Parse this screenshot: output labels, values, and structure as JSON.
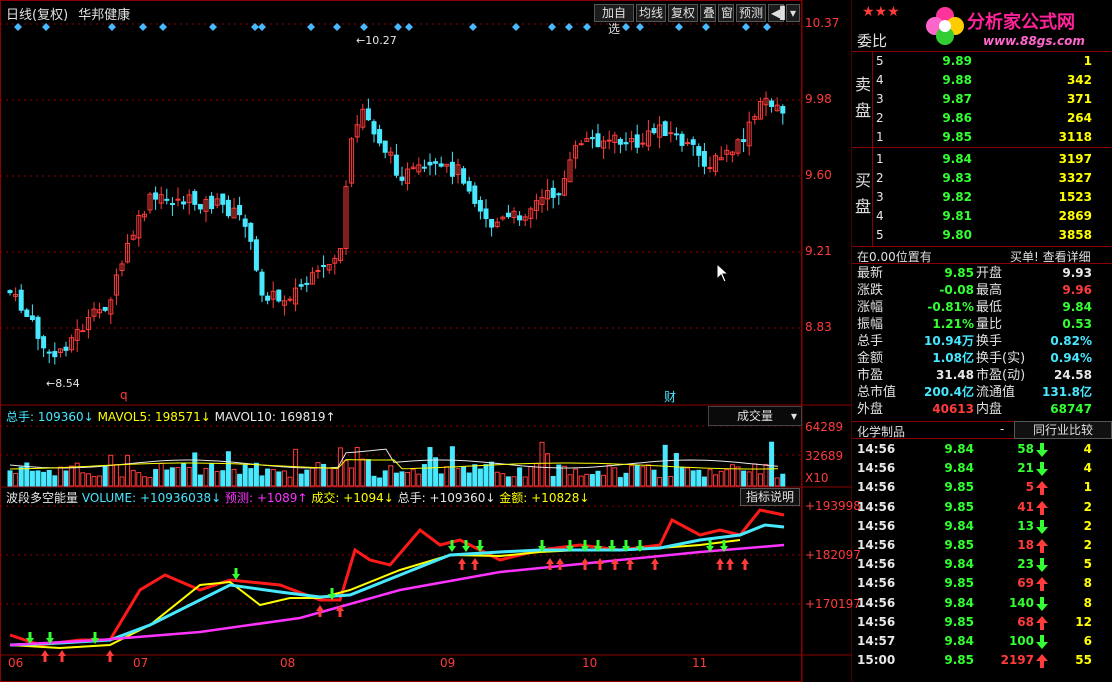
{
  "header": {
    "title": "日线(复权)",
    "stock_name": "华邦健康",
    "buttons": [
      "加自选",
      "均线",
      "复权",
      "叠",
      "窗",
      "预测"
    ],
    "stars": "★★★",
    "logo_text": "分析家公式网",
    "logo_url": "www.88gs.com"
  },
  "main_chart": {
    "price_labels": [
      "10.37",
      "9.98",
      "9.60",
      "9.21",
      "8.83"
    ],
    "high_label": "10.27",
    "low_label": "8.54",
    "markers": [
      "q",
      "财"
    ]
  },
  "volume_panel": {
    "label_total": "总手: 109360↓",
    "label_ma5": "MAVOL5: 198571↓",
    "label_ma10": "MAVOL10: 169819↑",
    "title": "成交量",
    "axis": [
      "64289",
      "32689",
      "X10"
    ]
  },
  "indicator_panel": {
    "name": "波段多空能量",
    "volume": "VOLUME: +10936038↓",
    "forecast": "预测: +1089↑",
    "deal": "成交: +1094↓",
    "total": "总手: +109360↓",
    "amount": "金额: +10828↓",
    "help": "指标说明",
    "axis": [
      "+193998",
      "+182097",
      "+170197"
    ]
  },
  "x_axis": [
    "06",
    "07",
    "08",
    "09",
    "10",
    "11"
  ],
  "order_book": {
    "title": "委比",
    "sell_label": "卖盘",
    "buy_label": "买盘",
    "sell": [
      {
        "level": "5",
        "price": "9.89",
        "vol": "1"
      },
      {
        "level": "4",
        "price": "9.88",
        "vol": "342"
      },
      {
        "level": "3",
        "price": "9.87",
        "vol": "371"
      },
      {
        "level": "2",
        "price": "9.86",
        "vol": "264"
      },
      {
        "level": "1",
        "price": "9.85",
        "vol": "3118"
      }
    ],
    "buy": [
      {
        "level": "1",
        "price": "9.84",
        "vol": "3197"
      },
      {
        "level": "2",
        "price": "9.83",
        "vol": "3327"
      },
      {
        "level": "3",
        "price": "9.82",
        "vol": "1523"
      },
      {
        "level": "4",
        "price": "9.81",
        "vol": "2869"
      },
      {
        "level": "5",
        "price": "9.80",
        "vol": "3858"
      }
    ]
  },
  "position_bar": {
    "left": "在0.00位置有",
    "right": "买单! 查看详细"
  },
  "quote": [
    {
      "l1": "最新",
      "v1": "9.85",
      "c1": "green",
      "l2": "开盘",
      "v2": "9.93",
      "c2": "white"
    },
    {
      "l1": "涨跌",
      "v1": "-0.08",
      "c1": "green",
      "l2": "最高",
      "v2": "9.96",
      "c2": "red"
    },
    {
      "l1": "涨幅",
      "v1": "-0.81%",
      "c1": "green",
      "l2": "最低",
      "v2": "9.84",
      "c2": "green"
    },
    {
      "l1": "振幅",
      "v1": "1.21%",
      "c1": "green",
      "l2": "量比",
      "v2": "0.53",
      "c2": "green"
    },
    {
      "l1": "总手",
      "v1": "10.94万",
      "c1": "cyan",
      "l2": "换手",
      "v2": "0.82%",
      "c2": "cyan"
    },
    {
      "l1": "金额",
      "v1": "1.08亿",
      "c1": "cyan",
      "l2": "换手(实)",
      "v2": "0.94%",
      "c2": "cyan"
    },
    {
      "l1": "市盈",
      "v1": "31.48",
      "c1": "white",
      "l2": "市盈(动)",
      "v2": "24.58",
      "c2": "white"
    },
    {
      "l1": "总市值",
      "v1": "200.4亿",
      "c1": "cyan",
      "l2": "流通值",
      "v2": "131.8亿",
      "c2": "cyan"
    },
    {
      "l1": "外盘",
      "v1": "40613",
      "c1": "red",
      "l2": "内盘",
      "v2": "68747",
      "c2": "green"
    }
  ],
  "industry_bar": {
    "left": "化学制品",
    "minus": "-",
    "right": "同行业比较"
  },
  "ticks": [
    {
      "time": "14:56",
      "price": "9.84",
      "vol": "58",
      "dir": "down",
      "n": "4"
    },
    {
      "time": "14:56",
      "price": "9.84",
      "vol": "21",
      "dir": "down",
      "n": "4"
    },
    {
      "time": "14:56",
      "price": "9.85",
      "vol": "5",
      "dir": "up",
      "n": "1"
    },
    {
      "time": "14:56",
      "price": "9.85",
      "vol": "41",
      "dir": "up",
      "n": "2"
    },
    {
      "time": "14:56",
      "price": "9.84",
      "vol": "13",
      "dir": "down",
      "n": "2"
    },
    {
      "time": "14:56",
      "price": "9.85",
      "vol": "18",
      "dir": "up",
      "n": "2"
    },
    {
      "time": "14:56",
      "price": "9.84",
      "vol": "23",
      "dir": "down",
      "n": "5"
    },
    {
      "time": "14:56",
      "price": "9.85",
      "vol": "69",
      "dir": "up",
      "n": "8"
    },
    {
      "time": "14:56",
      "price": "9.84",
      "vol": "140",
      "dir": "down",
      "n": "8"
    },
    {
      "time": "14:56",
      "price": "9.85",
      "vol": "68",
      "dir": "up",
      "n": "12"
    },
    {
      "time": "14:57",
      "price": "9.84",
      "vol": "100",
      "dir": "down",
      "n": "6"
    },
    {
      "time": "15:00",
      "price": "9.85",
      "vol": "2197",
      "dir": "up",
      "n": "55"
    }
  ],
  "colors": {
    "up": "#ff3b3b",
    "down": "#48e8ff",
    "grid": "#8b0000",
    "ma_white": "#e8e8e8",
    "ma_yellow": "#ffff00",
    "ma_magenta": "#ff33ff"
  }
}
